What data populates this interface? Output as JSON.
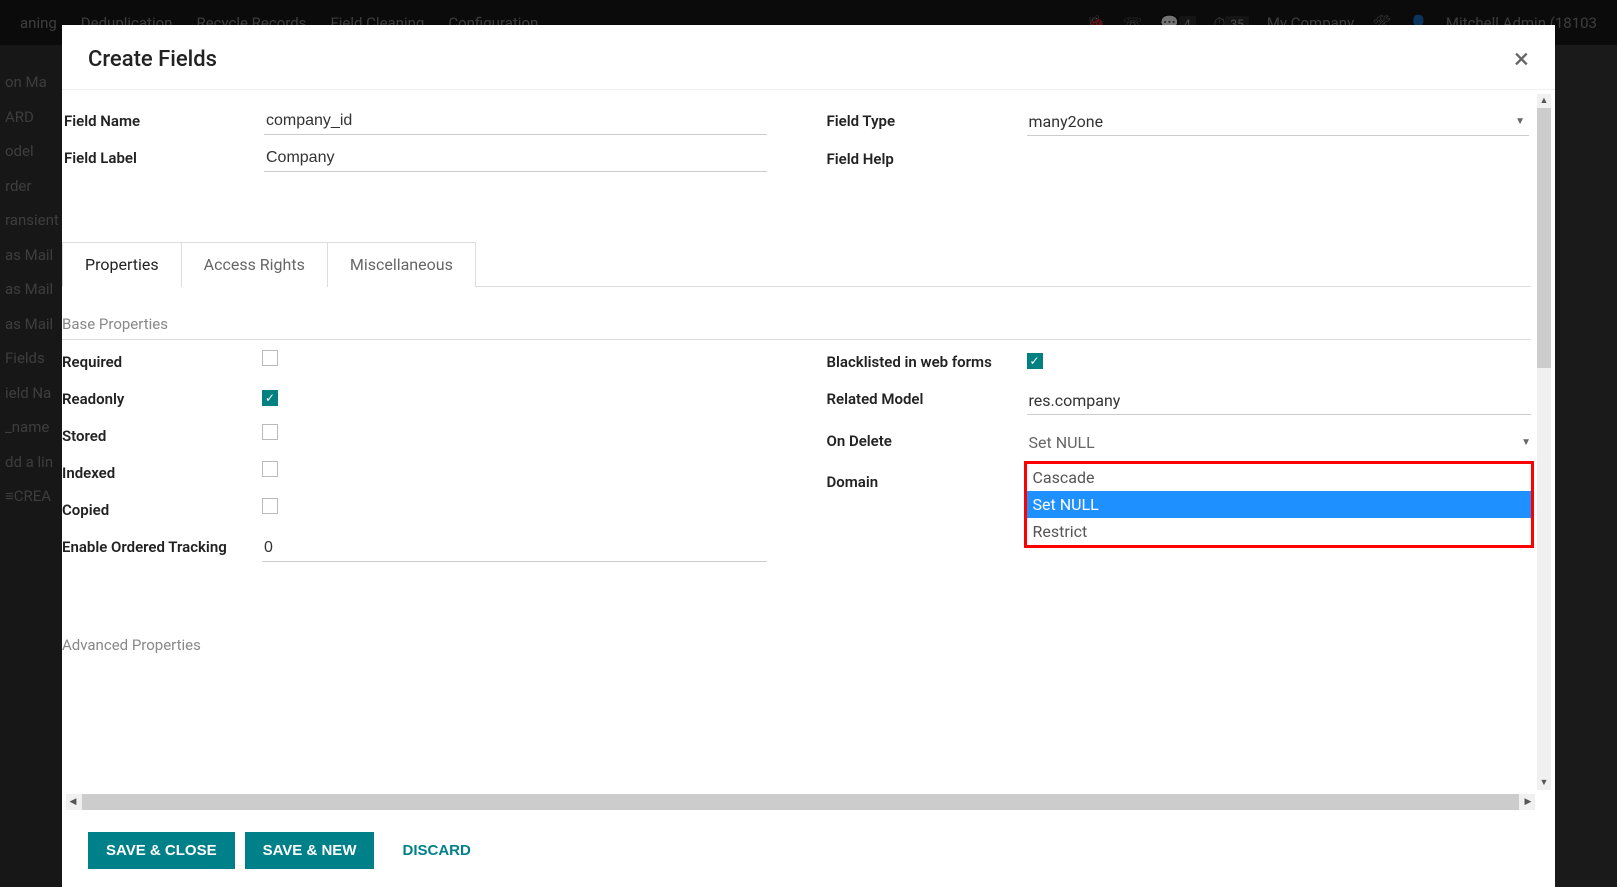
{
  "header": {
    "app": "aning",
    "menus": [
      "Deduplication",
      "Recycle Records",
      "Field Cleaning",
      "Configuration"
    ],
    "badge1": "4",
    "badge2": "35",
    "company": "My Company",
    "user": "Mitchell Admin (18103"
  },
  "bg_side": [
    "on Ma",
    "ARD",
    "odel",
    "rder",
    "ransient",
    "as Mail",
    "as Mail",
    "as Mail",
    "Fields",
    "ield Na",
    "_name",
    "dd a lin",
    "≡CREA"
  ],
  "modal": {
    "title": "Create Fields",
    "fields": {
      "name_label": "Field Name",
      "name_value": "company_id",
      "label_label": "Field Label",
      "label_value": "Company",
      "type_label": "Field Type",
      "type_value": "many2one",
      "help_label": "Field Help",
      "help_value": ""
    },
    "tabs": [
      "Properties",
      "Access Rights",
      "Miscellaneous"
    ],
    "active_tab": 0,
    "section_base": "Base Properties",
    "section_adv": "Advanced Properties",
    "left_props": {
      "required": "Required",
      "readonly": "Readonly",
      "stored": "Stored",
      "indexed": "Indexed",
      "copied": "Copied",
      "tracking_label": "Enable Ordered Tracking",
      "tracking_value": "0"
    },
    "right_props": {
      "blacklisted": "Blacklisted in web forms",
      "related_model_label": "Related Model",
      "related_model_value": "res.company",
      "on_delete_label": "On Delete",
      "on_delete_value": "Set NULL",
      "domain_label": "Domain",
      "options": [
        "Cascade",
        "Set NULL",
        "Restrict"
      ],
      "selected_option_index": 1
    },
    "checks": {
      "required": false,
      "readonly": true,
      "stored": false,
      "indexed": false,
      "copied": false,
      "blacklisted": true
    },
    "footer": {
      "save_close": "SAVE & CLOSE",
      "save_new": "SAVE & NEW",
      "discard": "DISCARD"
    }
  }
}
